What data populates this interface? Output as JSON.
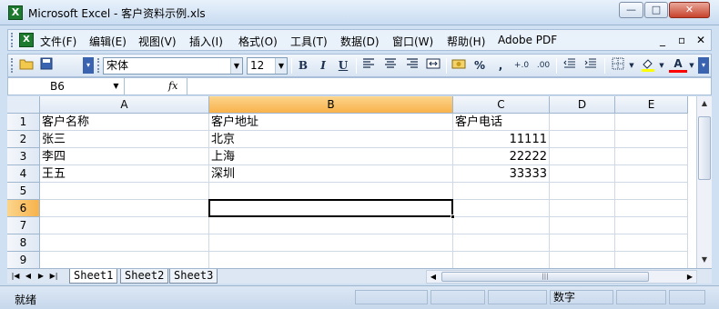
{
  "window": {
    "title": "Microsoft Excel - 客户资料示例.xls",
    "app_icon": "X",
    "minimize": "—",
    "maximize": "□",
    "close": "✕"
  },
  "menubar": {
    "items": [
      "文件(F)",
      "编辑(E)",
      "视图(V)",
      "插入(I)",
      "格式(O)",
      "工具(T)",
      "数据(D)",
      "窗口(W)",
      "帮助(H)",
      "Adobe PDF"
    ],
    "doc_minimize": "_",
    "doc_restore": "▫",
    "doc_close": "✕"
  },
  "toolbar": {
    "font_name": "宋体",
    "font_size": "12",
    "bold": "B",
    "italic": "I",
    "underline": "U",
    "percent": "%",
    "comma": ",",
    "font_color_label": "A"
  },
  "formula": {
    "name_box": "B6",
    "fx_label": "fx",
    "value": ""
  },
  "sheet": {
    "columns": [
      "A",
      "B",
      "C",
      "D",
      "E"
    ],
    "selected_column": "B",
    "rows": [
      "1",
      "2",
      "3",
      "4",
      "5",
      "6",
      "7",
      "8",
      "9"
    ],
    "selected_row": "6",
    "cells": {
      "A1": "客户名称",
      "B1": "客户地址",
      "C1": "客户电话",
      "A2": "张三",
      "B2": "北京",
      "C2": "11111",
      "A3": "李四",
      "B3": "上海",
      "C3": "22222",
      "A4": "王五",
      "B4": "深圳",
      "C4": "33333"
    },
    "active_cell": "B6"
  },
  "tabs": {
    "sheets": [
      "Sheet1",
      "Sheet2",
      "Sheet3"
    ],
    "active": "Sheet1"
  },
  "status": {
    "ready": "就绪",
    "numlock": "数字"
  }
}
